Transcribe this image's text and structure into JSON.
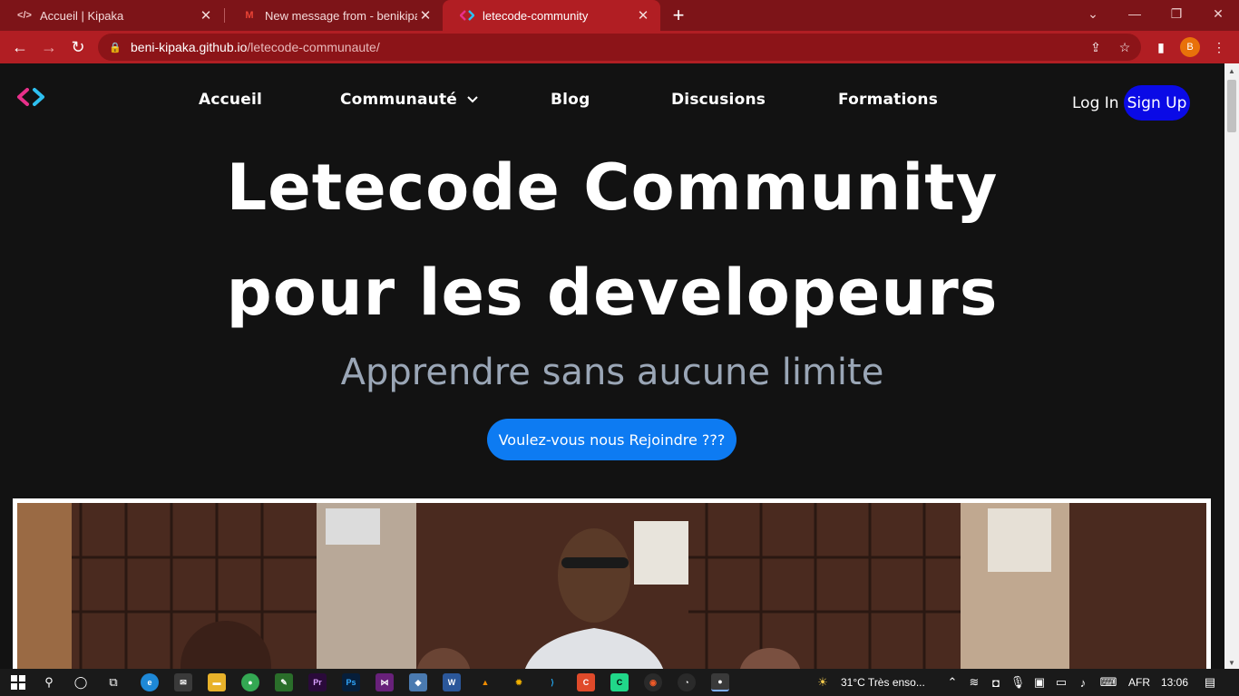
{
  "browser": {
    "tabs": [
      {
        "title": "Accueil | Kipaka",
        "icon": "code-icon"
      },
      {
        "title": "New message from - benikipaka@",
        "icon": "gmail-icon"
      },
      {
        "title": "letecode-community",
        "icon": "letecode-icon",
        "active": true
      }
    ],
    "url_host": "beni-kipaka.github.io",
    "url_path": "/letecode-communaute/",
    "profile_initial": "B",
    "accent": "#b11e23"
  },
  "page": {
    "nav": {
      "links": [
        "Accueil",
        "Communauté",
        "Blog",
        "Discusions",
        "Formations"
      ],
      "login": "Log In",
      "signup": "Sign Up"
    },
    "hero": {
      "title_line1": "Letecode Community",
      "title_line2": "pour les developeurs",
      "subtitle": "Apprendre sans aucune limite",
      "cta": "Voulez-vous nous Rejoindre ???"
    },
    "colors": {
      "background": "#121212",
      "signup_bg": "#0a0ae6",
      "cta_bg": "#0d7bf2",
      "subtitle": "#9aa6b6"
    }
  },
  "taskbar": {
    "weather": "31°C  Très enso...",
    "language": "AFR",
    "time": "13:06"
  }
}
